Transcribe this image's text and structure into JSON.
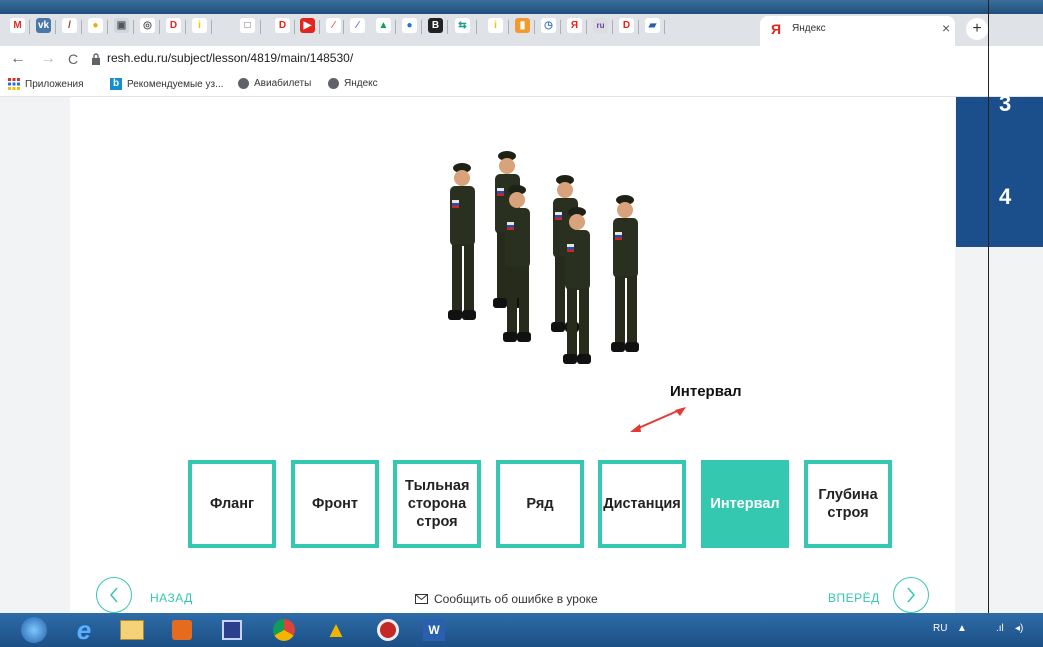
{
  "browser": {
    "tab_icons": [
      "gmail-icon",
      "vk-icon",
      "pen-icon",
      "paint-icon",
      "image-icon",
      "chrome-icon",
      "yandex-d-icon",
      "info-icon",
      "screen-icon",
      "yandex-d-icon",
      "youtube-icon",
      "pdf-icon",
      "pdf-icon",
      "drive-icon",
      "maps-icon",
      "b-icon",
      "swap-icon",
      "info-icon",
      "orange-icon",
      "clock-icon",
      "yandex-icon",
      "doc-icon",
      "yandex-d-icon",
      "book-icon"
    ],
    "active_tab": {
      "icon": "yandex-icon",
      "title": "Яндекс",
      "close": "×"
    },
    "new_tab_label": "+",
    "url": "resh.edu.ru/subject/lesson/4819/main/148530/",
    "nav": {
      "back": "←",
      "forward": "→",
      "reload": "C"
    },
    "bookmarks": [
      {
        "label": "Приложения",
        "icon": "apps-icon"
      },
      {
        "label": "Рекомендуемые уз...",
        "icon": "bing-icon"
      },
      {
        "label": "Авиабилеты",
        "icon": "globe-icon"
      },
      {
        "label": "Яндекс",
        "icon": "globe-icon"
      }
    ]
  },
  "side_panel": {
    "numbers": [
      "3",
      "4"
    ],
    "color": "#1b4f8c"
  },
  "lesson": {
    "interval_label": "Интервал",
    "cards": [
      {
        "label": "Фланг",
        "active": false
      },
      {
        "label": "Фронт",
        "active": false
      },
      {
        "label": "Тыльная сторона строя",
        "active": false
      },
      {
        "label": "Ряд",
        "active": false
      },
      {
        "label": "Дистанция",
        "active": false
      },
      {
        "label": "Интервал",
        "active": true
      },
      {
        "label": "Глубина строя",
        "active": false
      }
    ],
    "accent_color": "#34c8b0",
    "back_label": "НАЗАД",
    "forward_label": "ВПЕРЁД",
    "report_label": "Сообщить об ошибке в уроке"
  },
  "taskbar": {
    "apps": [
      "start-orb-icon",
      "ie-icon",
      "explorer-icon",
      "media-icon",
      "save-icon",
      "chrome-icon",
      "drive-icon",
      "opera-icon",
      "word-icon"
    ],
    "lang": "RU"
  }
}
